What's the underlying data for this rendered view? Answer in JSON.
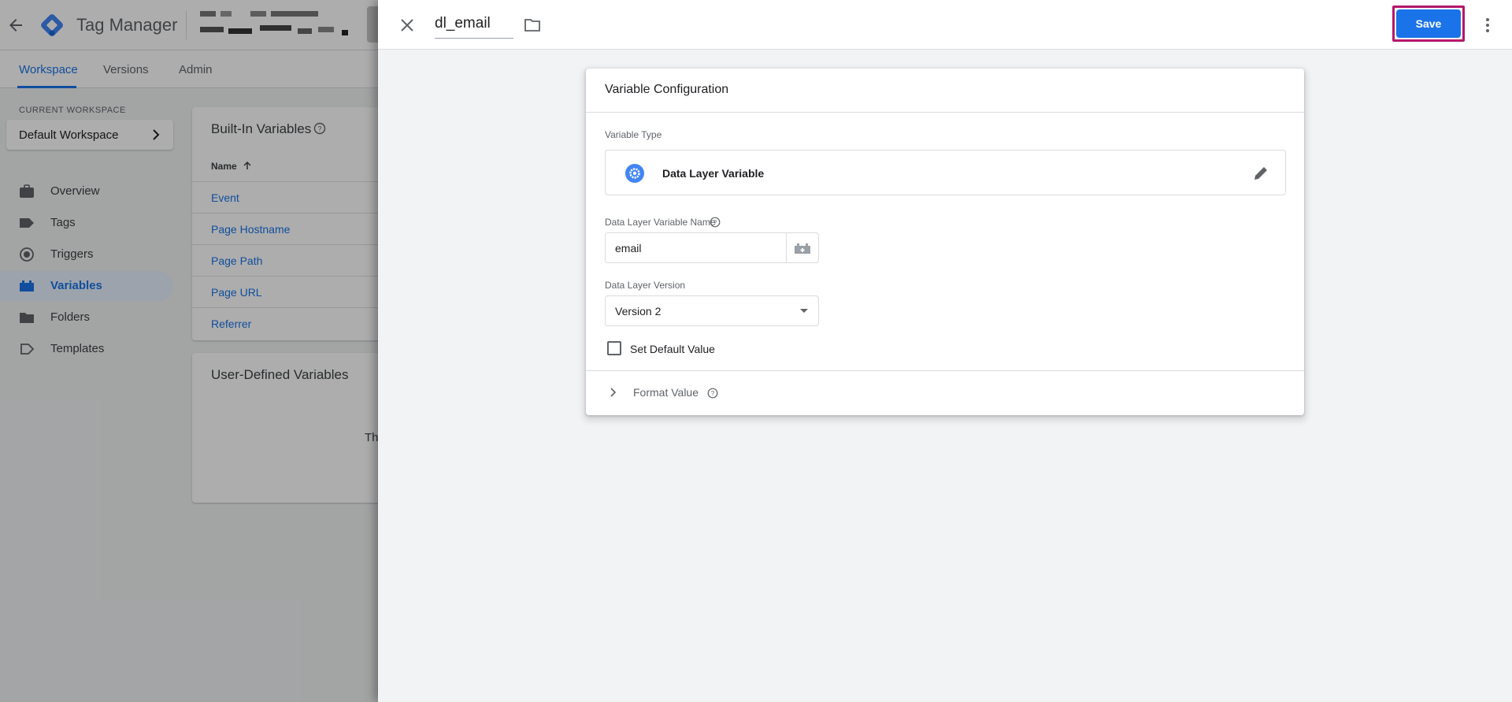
{
  "app": {
    "title": "Tag Manager"
  },
  "nav_tabs": [
    {
      "label": "Workspace",
      "active": true
    },
    {
      "label": "Versions",
      "active": false
    },
    {
      "label": "Admin",
      "active": false
    }
  ],
  "workspace": {
    "section_label": "CURRENT WORKSPACE",
    "name": "Default Workspace"
  },
  "sidebar": {
    "items": [
      {
        "label": "Overview",
        "icon": "briefcase-icon",
        "active": false
      },
      {
        "label": "Tags",
        "icon": "tag-icon",
        "active": false
      },
      {
        "label": "Triggers",
        "icon": "trigger-icon",
        "active": false
      },
      {
        "label": "Variables",
        "icon": "variables-icon",
        "active": true
      },
      {
        "label": "Folders",
        "icon": "folder-icon",
        "active": false
      },
      {
        "label": "Templates",
        "icon": "template-icon",
        "active": false
      }
    ]
  },
  "built_in": {
    "title": "Built-In Variables",
    "column_name": "Name",
    "rows": [
      "Event",
      "Page Hostname",
      "Page Path",
      "Page URL",
      "Referrer"
    ]
  },
  "user_defined": {
    "title": "User-Defined Variables",
    "fragment": "Th"
  },
  "editor": {
    "variable_name": "dl_email",
    "save_label": "Save",
    "config": {
      "title": "Variable Configuration",
      "type_label": "Variable Type",
      "type_name": "Data Layer Variable",
      "dl_name_label": "Data Layer Variable Name",
      "dl_name_value": "email",
      "dl_version_label": "Data Layer Version",
      "dl_version_value": "Version 2",
      "default_value_label": "Set Default Value",
      "default_value_checked": false,
      "format_value_label": "Format Value"
    }
  },
  "colors": {
    "accent": "#1a73e8",
    "save_highlight": "#b4176b",
    "logo_blue": "#4285f4"
  }
}
